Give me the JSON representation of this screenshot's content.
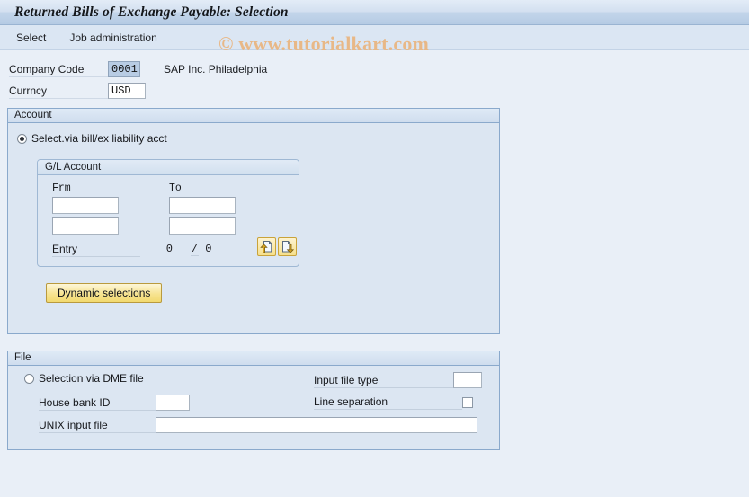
{
  "window": {
    "title": "Returned Bills of Exchange Payable: Selection"
  },
  "menu": {
    "items": [
      {
        "label": "Select"
      },
      {
        "label": "Job administration"
      }
    ]
  },
  "watermark": {
    "text": "© www.tutorialkart.com",
    "color": "#e8b887"
  },
  "header": {
    "company_code": {
      "label": "Company Code",
      "value": "0001",
      "selected": true,
      "description": "SAP Inc. Philadelphia"
    },
    "currency": {
      "label": "Currncy",
      "value": "USD"
    }
  },
  "account_panel": {
    "title": "Account",
    "radio": {
      "label": "Select.via bill/ex liability acct",
      "selected": true
    },
    "gl_group": {
      "title": "G/L Account",
      "col_from": "Frm",
      "col_to": "To",
      "rows": [
        {
          "from": "",
          "to": ""
        },
        {
          "from": "",
          "to": ""
        }
      ],
      "entry_label": "Entry",
      "entry_count": "0",
      "entry_separator": "/",
      "entry_total": "0",
      "icon_buttons": [
        {
          "name": "multiple-selection-up-icon",
          "title": ""
        },
        {
          "name": "multiple-selection-down-icon",
          "title": ""
        }
      ]
    },
    "dynamic_selections_button": "Dynamic selections"
  },
  "file_panel": {
    "title": "File",
    "radio": {
      "label": "Selection via DME file",
      "selected": false
    },
    "house_bank_id": {
      "label": "House bank ID",
      "value": ""
    },
    "unix_input_file": {
      "label": "UNIX input file",
      "value": ""
    },
    "input_file_type": {
      "label": "Input file type",
      "value": ""
    },
    "line_separation": {
      "label": "Line separation",
      "checked": false
    }
  },
  "colors": {
    "page_background": "#e9eff7",
    "panel_background": "#dce6f2",
    "panel_border": "#8aa9cc",
    "button_accent": "#f2d96f",
    "title_text": "#15181c"
  }
}
